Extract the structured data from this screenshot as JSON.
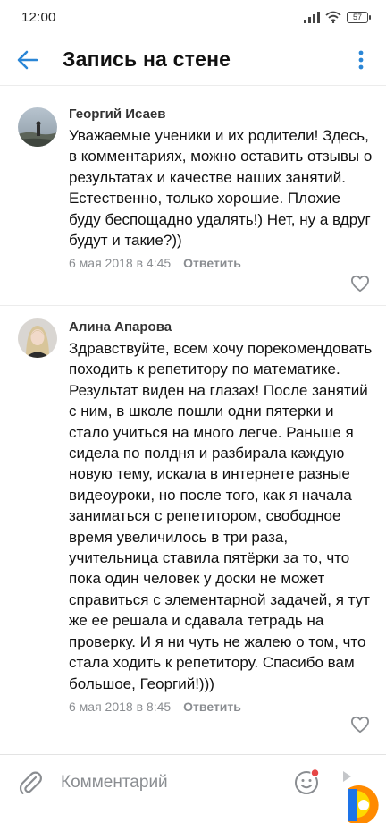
{
  "status_bar": {
    "time": "12:00",
    "battery": "57"
  },
  "header": {
    "title": "Запись на стене",
    "back_icon": "arrow-left-icon",
    "more_icon": "more-vertical-icon"
  },
  "comments": [
    {
      "author": "Георгий Исаев",
      "text": "Уважаемые ученики и их родители! Здесь, в комментариях, можно оставить отзывы о результатах и качестве наших занятий. Естественно, только хорошие. Плохие буду беспощадно удалять!) Нет, ну а вдруг будут и такие?))",
      "date": "6 мая 2018 в 4:45",
      "reply_label": "Ответить"
    },
    {
      "author": "Алина Апарова",
      "text": "Здравствуйте, всем хочу порекомендовать походить к репетитору по математике. Результат виден на глазах! После занятий с ним, в школе пошли одни пятерки и стало учиться на много легче. Раньше я сидела по полдня и разбирала каждую новую тему, искала в интернете разные видеоуроки, но после того, как я начала заниматься с репетитором, свободное время увеличилось в три раза, учительница ставила пятёрки за то, что пока один человек у доски не может справиться с элементарной задачей, я тут же ее решала и сдавала тетрадь на проверку. И я ни чуть не жалею о том, что стала ходить к репетитору. Спасибо вам большое, Георгий!)))",
      "date": "6 мая 2018 в 8:45",
      "reply_label": "Ответить"
    }
  ],
  "input_bar": {
    "placeholder": "Комментарий",
    "attach_icon": "paperclip-icon",
    "emoji_icon": "smile-icon",
    "send_icon": "send-icon"
  },
  "colors": {
    "accent": "#2a86d6",
    "secondary_text": "#8a8d91",
    "notification_dot": "#e64646"
  }
}
